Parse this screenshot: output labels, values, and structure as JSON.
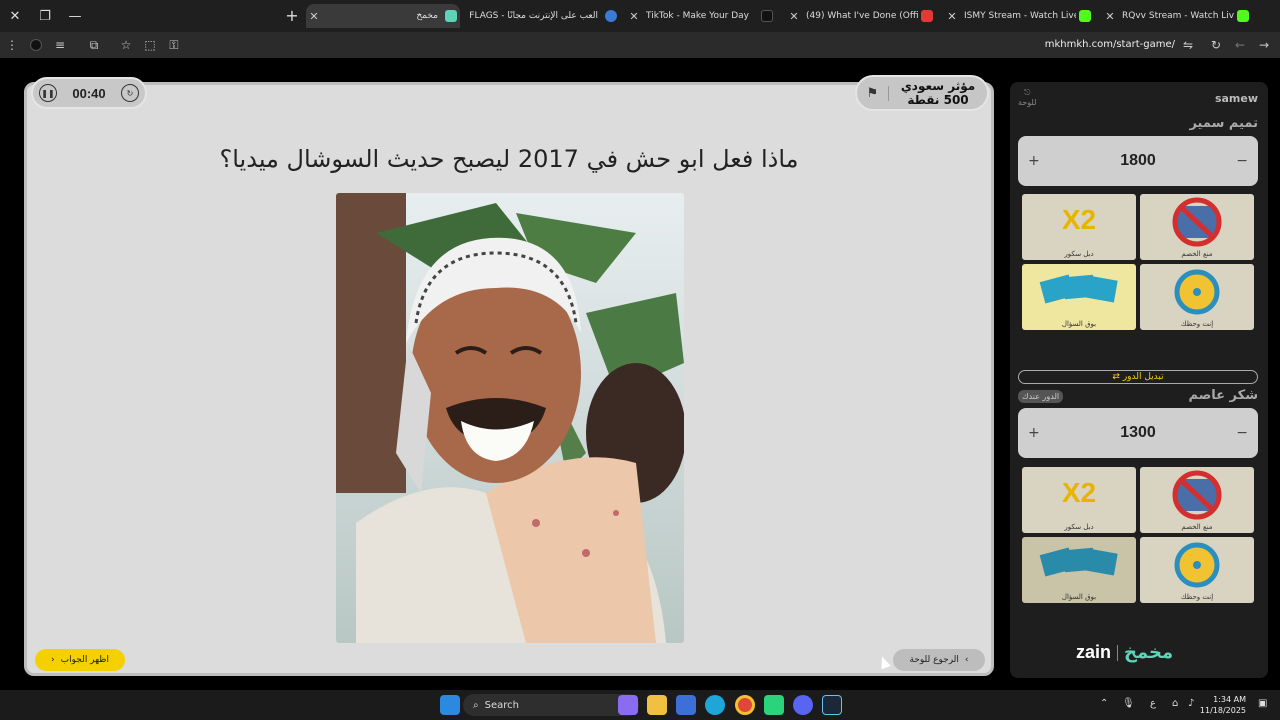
{
  "browser": {
    "tabs": [
      {
        "title": "مخمخ",
        "active": true
      },
      {
        "title": "FLAGS - العب على الإنترنت مجانًا"
      },
      {
        "title": "TikTok - Make Your Day"
      },
      {
        "title": "(49) What I've Done (Official M"
      },
      {
        "title": "ISMY Stream - Watch Live on K"
      },
      {
        "title": "RQvv Stream - Watch Live on K"
      }
    ],
    "url": "mkhmkh.com/start-game/"
  },
  "game": {
    "timer": "00:40",
    "category": {
      "name": "مؤثر سعودي",
      "points": "500 نقطة"
    },
    "question": "ماذا فعل ابو حش في 2017 ليصبح حديث السوشال ميديا؟",
    "reveal_label": "اظهر الجواب",
    "back_label": "الرجوع للوحة"
  },
  "panel": {
    "logout_label": "للوحة",
    "username": "samew",
    "teams": [
      {
        "name": "تميم سمير",
        "score": "1800"
      },
      {
        "name": "شكر عاصم",
        "score": "1300",
        "badge": "الدور عندك"
      }
    ],
    "powerups": [
      "دبل سكور",
      "منع الخصم",
      "بوق السؤال",
      "إنت وحظك"
    ],
    "powerup_x2": "X2",
    "switch_label": "تبديل الدور",
    "brand": "zain",
    "brand_logo": "مخمخ"
  },
  "taskbar": {
    "search": "Search",
    "time": "1:34 AM",
    "date": "11/18/2025"
  },
  "colors": {
    "accent_yellow": "#f4d000",
    "board_bg": "#dcdcdc",
    "panel_bg": "#1e1e1e"
  }
}
